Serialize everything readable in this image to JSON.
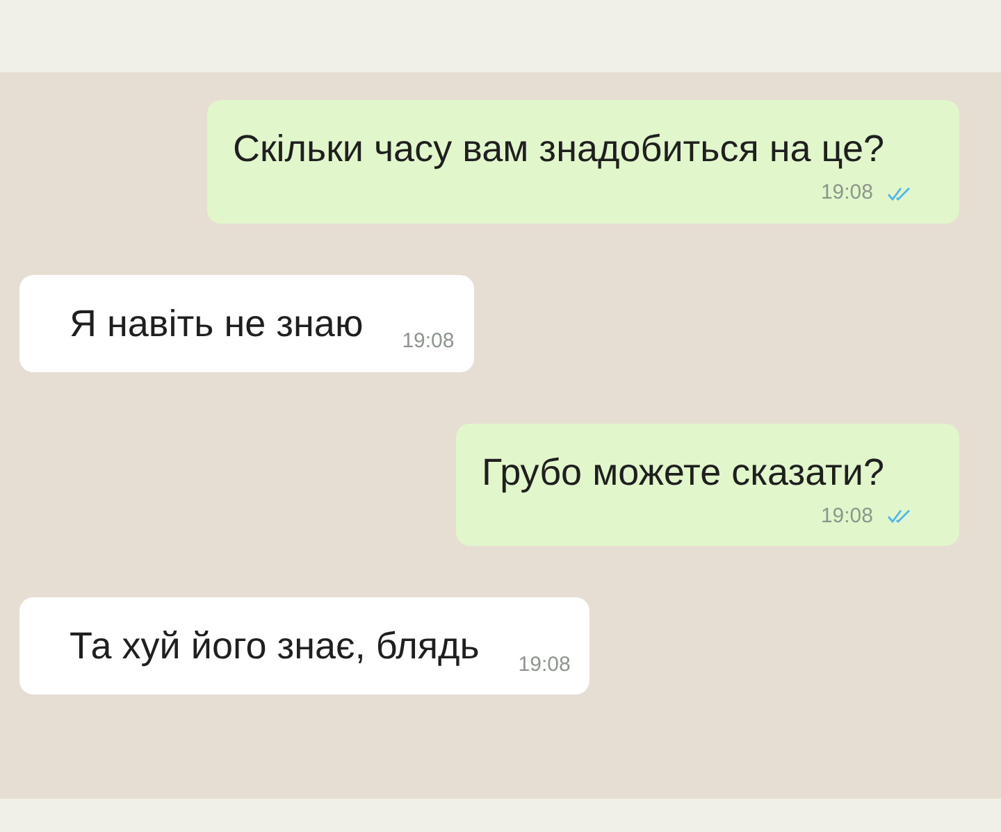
{
  "messages": [
    {
      "kind": "outgoing",
      "text": "Скільки часу вам знадобиться на це?",
      "time": "19:08",
      "read": true
    },
    {
      "kind": "incoming",
      "text": "Я навіть не знаю",
      "time": "19:08"
    },
    {
      "kind": "outgoing",
      "text": "Грубо можете сказати?",
      "time": "19:08",
      "read": true
    },
    {
      "kind": "incoming",
      "text": "Та хуй його знає, блядь",
      "time": "19:08"
    }
  ]
}
